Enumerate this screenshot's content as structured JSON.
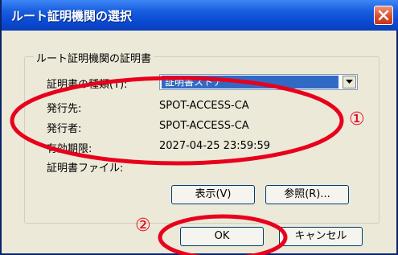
{
  "window": {
    "title": "ルート証明機関の選択"
  },
  "group": {
    "legend": "ルート証明機関の証明書"
  },
  "fields": {
    "cert_type_label": "証明書の種類(T):",
    "cert_type_value": "証明書ストア",
    "issued_to_label": "発行先:",
    "issued_to_value": "SPOT-ACCESS-CA",
    "issued_by_label": "発行者:",
    "issued_by_value": "SPOT-ACCESS-CA",
    "expiry_label": "有効期限:",
    "expiry_value": "2027-04-25 23:59:59",
    "cert_file_label": "証明書ファイル:"
  },
  "buttons": {
    "view": "表示(V)",
    "browse": "参照(R)...",
    "ok": "OK",
    "cancel": "キャンセル"
  },
  "annotations": {
    "marker1": "①",
    "marker2": "②",
    "color": "#e8001c"
  },
  "icons": {
    "close": "close-icon",
    "dropdown": "chevron-down-icon"
  }
}
